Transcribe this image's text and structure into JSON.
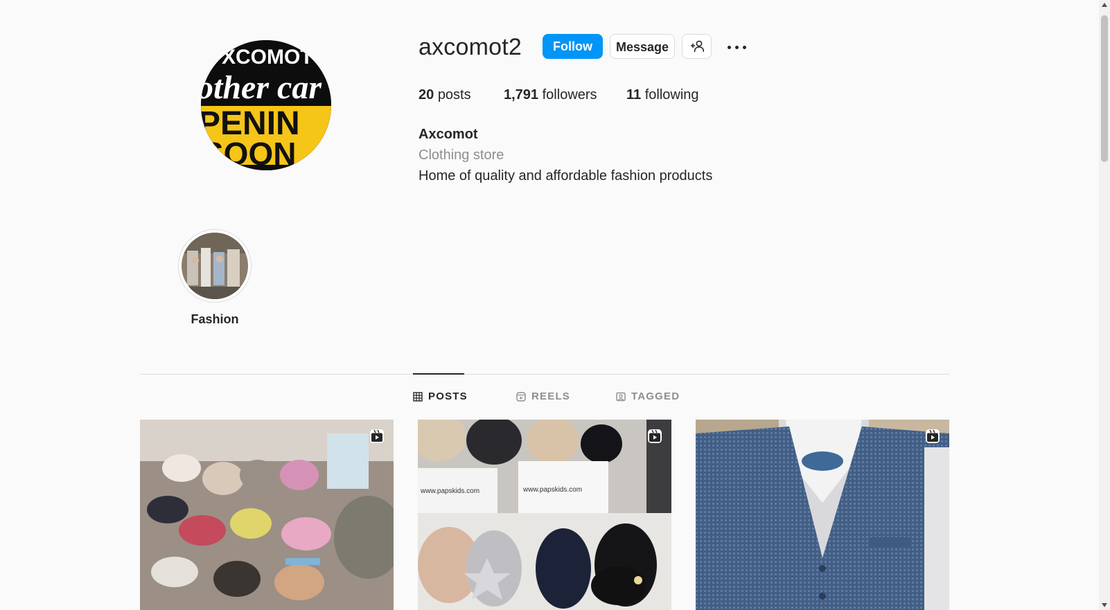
{
  "profile": {
    "username": "axcomot2",
    "full_name": "Axcomot",
    "category": "Clothing store",
    "bio": "Home of quality and affordable fashion products",
    "avatar_text": [
      "XCOMOT",
      "other car",
      "PENIN",
      "SOON"
    ]
  },
  "actions": {
    "follow": "Follow",
    "message": "Message",
    "suggest_icon": "add-person-icon",
    "more_icon": "more-options-icon"
  },
  "stats": {
    "posts_count": "20",
    "posts_label": "posts",
    "followers_count": "1,791",
    "followers_label": "followers",
    "following_count": "11",
    "following_label": "following"
  },
  "highlights": [
    {
      "label": "Fashion"
    }
  ],
  "tabs": [
    {
      "label": "POSTS",
      "icon": "grid-icon",
      "active": true
    },
    {
      "label": "REELS",
      "icon": "reels-icon",
      "active": false
    },
    {
      "label": "TAGGED",
      "icon": "tagged-icon",
      "active": false
    }
  ],
  "posts": [
    {
      "type": "reel",
      "icon": "reel-icon",
      "overlay_text": []
    },
    {
      "type": "reel",
      "icon": "reel-icon",
      "overlay_text": [
        "www.papskids.com",
        "www.papskids.com"
      ]
    },
    {
      "type": "reel",
      "icon": "reel-icon",
      "overlay_text": []
    }
  ],
  "colors": {
    "accent": "#0095f6",
    "background": "#fafafa",
    "text": "#262626",
    "muted": "#8e8e8e",
    "border": "#dbdbdb",
    "avatar_yellow": "#f5c518"
  }
}
